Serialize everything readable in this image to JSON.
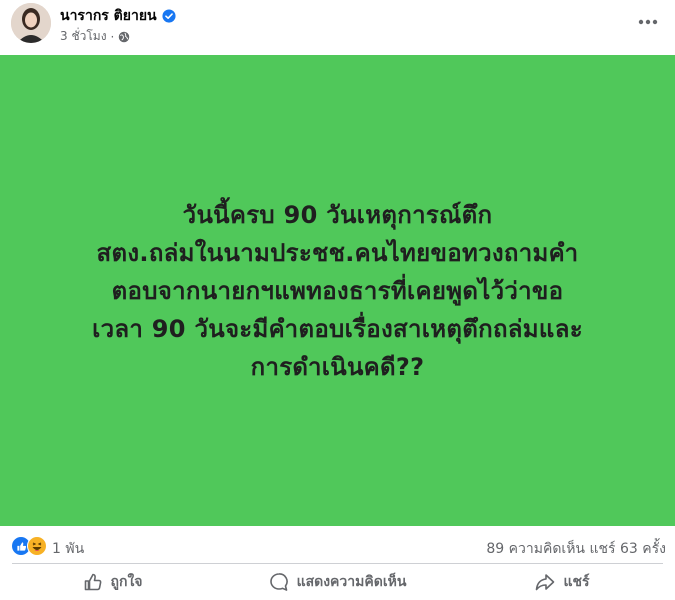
{
  "post": {
    "author": "นารากร ติยายน",
    "time": "3 ชั่วโมง",
    "separator": "·",
    "text": "วันนี้ครบ 90 วันเหตุการณ์ตึก\nสตง.ถล่มในนามประชช.คนไทยขอทวงถามคำ\nตอบจากนายกฯแพทองธารที่เคยพูดไว้ว่าขอ\nเวลา 90 วันจะมีคำตอบเรื่องสาเหตุตึกถล่มและ\nการดำเนินคดี??",
    "background_color": "#50c85a"
  },
  "stats": {
    "reactions": "1 พัน",
    "comments": "89 ความคิดเห็น",
    "shares": "แชร์ 63 ครั้ง"
  },
  "actions": {
    "like": "ถูกใจ",
    "comment": "แสดงความคิดเห็น",
    "share": "แชร์"
  },
  "icons": {
    "more": "more-horizontal-icon",
    "verified": "verified-badge-icon",
    "privacy": "globe-icon",
    "like_reaction": "like-reaction-icon",
    "haha_reaction": "haha-reaction-icon"
  }
}
